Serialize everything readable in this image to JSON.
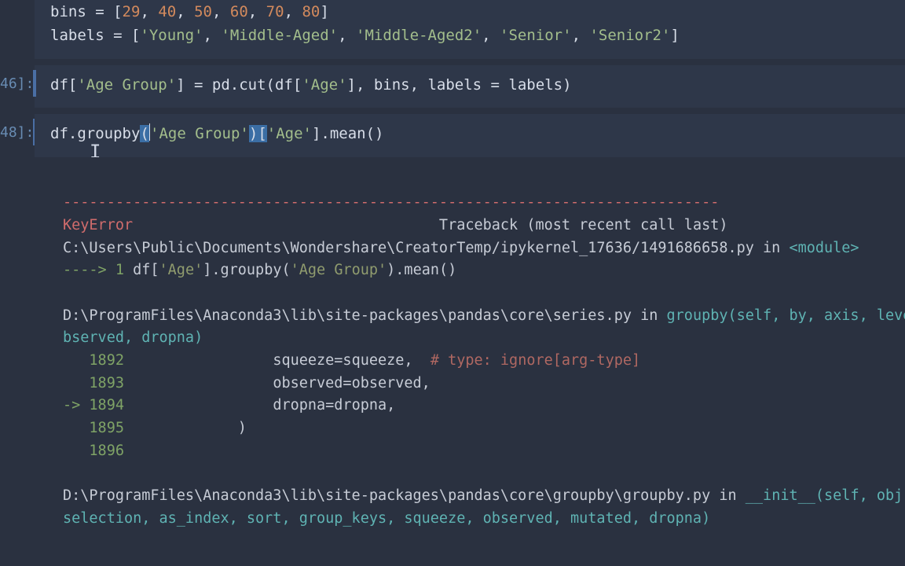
{
  "cells": {
    "c0": {
      "prompt": "",
      "bins_var": "bins",
      "bins_eq": " = ",
      "bins_open": "[",
      "bins_nums": [
        "29",
        "40",
        "50",
        "60",
        "70",
        "80"
      ],
      "bins_sep": ", ",
      "bins_close": "]",
      "labels_var": "labels",
      "labels_eq": " = ",
      "labels_open": "[",
      "labels_vals": [
        "'Young'",
        "'Middle-Aged'",
        "'Middle-Aged2'",
        "'Senior'",
        "'Senior2'"
      ],
      "labels_sep": ", ",
      "labels_close": "]"
    },
    "c1": {
      "prompt": "46]:",
      "pre": "df[",
      "str1": "'Age Group'",
      "mid1": "] = pd.cut(df[",
      "str2": "'Age'",
      "mid2": "], bins, labels = labels)"
    },
    "c2": {
      "prompt": "48]:",
      "pre": "df.groupby",
      "p1": "(",
      "str1": "'Age Group'",
      "p2": ")",
      "b1": "[",
      "str2": "'Age'",
      "b2": "].mean()"
    }
  },
  "traceback": {
    "dashes": "---------------------------------------------------------------------------",
    "err_name": "KeyError",
    "trace_hdr": "                                   Traceback (most recent call last)",
    "file1_path": "C:\\Users\\Public\\Documents\\Wondershare\\CreatorTemp/ipykernel_17636/1491686658.py",
    "file1_in": " in ",
    "file1_mod": "<module>",
    "arrow1": "----> ",
    "ln1": "1",
    "code1_a": " df[",
    "code1_s1": "'Age'",
    "code1_b": "].groupby(",
    "code1_s2": "'Age Group'",
    "code1_c": ").mean()",
    "file2_path": "D:\\ProgramFiles\\Anaconda3\\lib\\site-packages\\pandas\\core\\series.py",
    "file2_in": " in ",
    "file2_func": "groupby",
    "file2_sig": "(self, by, axis, level, as_index",
    "file2_sig2": "bserved, dropna)",
    "l1892_n": "1892",
    "l1892_c": "                 squeeze=squeeze,  ",
    "l1892_cm": "# type: ignore[arg-type]",
    "l1893_n": "1893",
    "l1893_c": "                 observed=observed,",
    "l1894_arrow": "-> ",
    "l1894_n": "1894",
    "l1894_c": "                 dropna=dropna,",
    "l1895_n": "1895",
    "l1895_c": "             )",
    "l1896_n": "1896",
    "file3_path": "D:\\ProgramFiles\\Anaconda3\\lib\\site-packages\\pandas\\core\\groupby\\groupby.py",
    "file3_in": " in ",
    "file3_func": "__init__",
    "file3_sig": "(self, obj, keys, axis",
    "file3_sig2": "selection, as_index, sort, group_keys, squeeze, observed, mutated, dropna)"
  }
}
